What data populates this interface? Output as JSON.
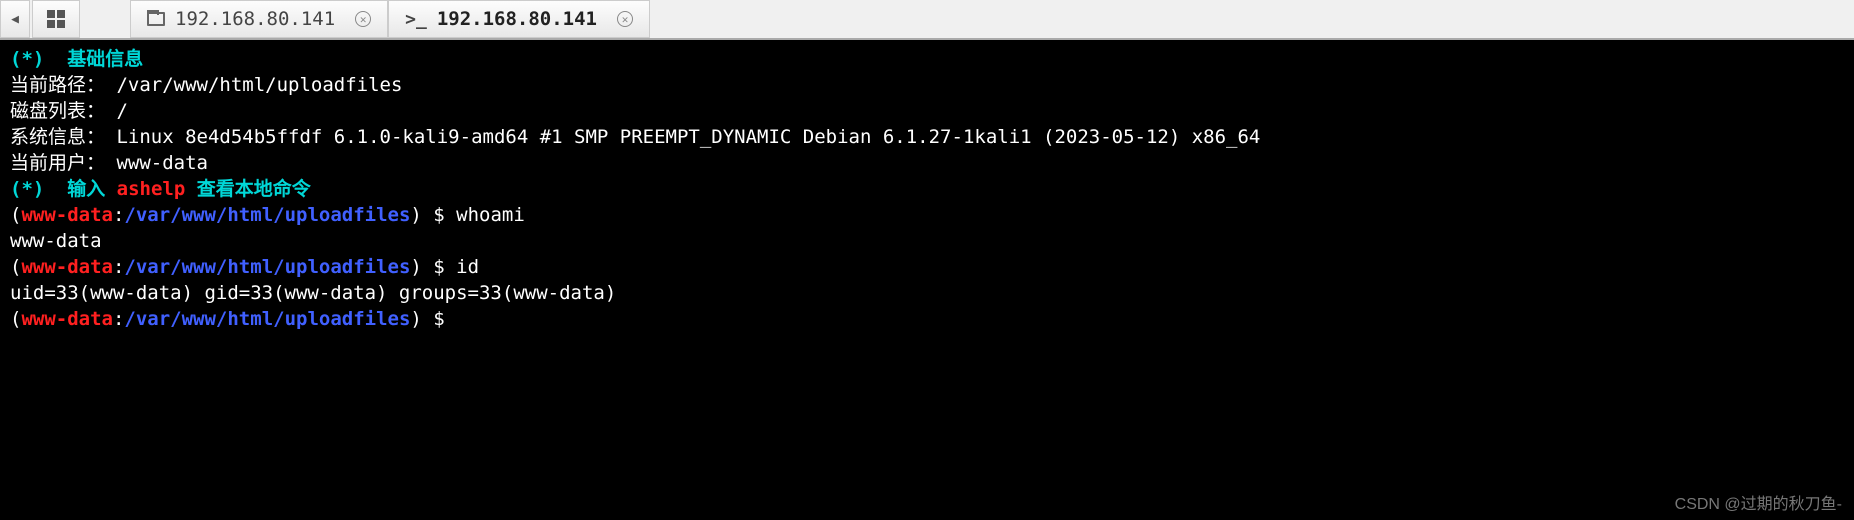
{
  "tabs": {
    "back_arrow": "◀",
    "tab1": {
      "label": "192.168.80.141"
    },
    "tab2": {
      "label": "192.168.80.141",
      "prompt_symbol": ">_"
    }
  },
  "info": {
    "section_basic_marker": "(*)",
    "section_basic_title": "  基础信息",
    "path_label": "当前路径：",
    "path_value": " /var/www/html/uploadfiles",
    "disk_label": "磁盘列表：",
    "disk_value": " /",
    "sys_label": "系统信息：",
    "sys_value": " Linux 8e4d54b5ffdf 6.1.0-kali9-amd64 #1 SMP PREEMPT_DYNAMIC Debian 6.1.27-1kali1 (2023-05-12) x86_64",
    "user_label": "当前用户：",
    "user_value": " www-data",
    "section_help_marker": "(*)",
    "section_help_prefix": "  输入 ",
    "section_help_cmd": "ashelp",
    "section_help_suffix": " 查看本地命令"
  },
  "prompt": {
    "lparen": "(",
    "user": "www-data",
    "colon": ":",
    "path": "/var/www/html/uploadfiles",
    "rparen_dollar": ") $ "
  },
  "session": {
    "cmd1": "whoami",
    "out1": "www-data",
    "cmd2": "id",
    "out2": "uid=33(www-data) gid=33(www-data) groups=33(www-data)",
    "cmd3": ""
  },
  "watermark": "CSDN @过期的秋刀鱼-"
}
